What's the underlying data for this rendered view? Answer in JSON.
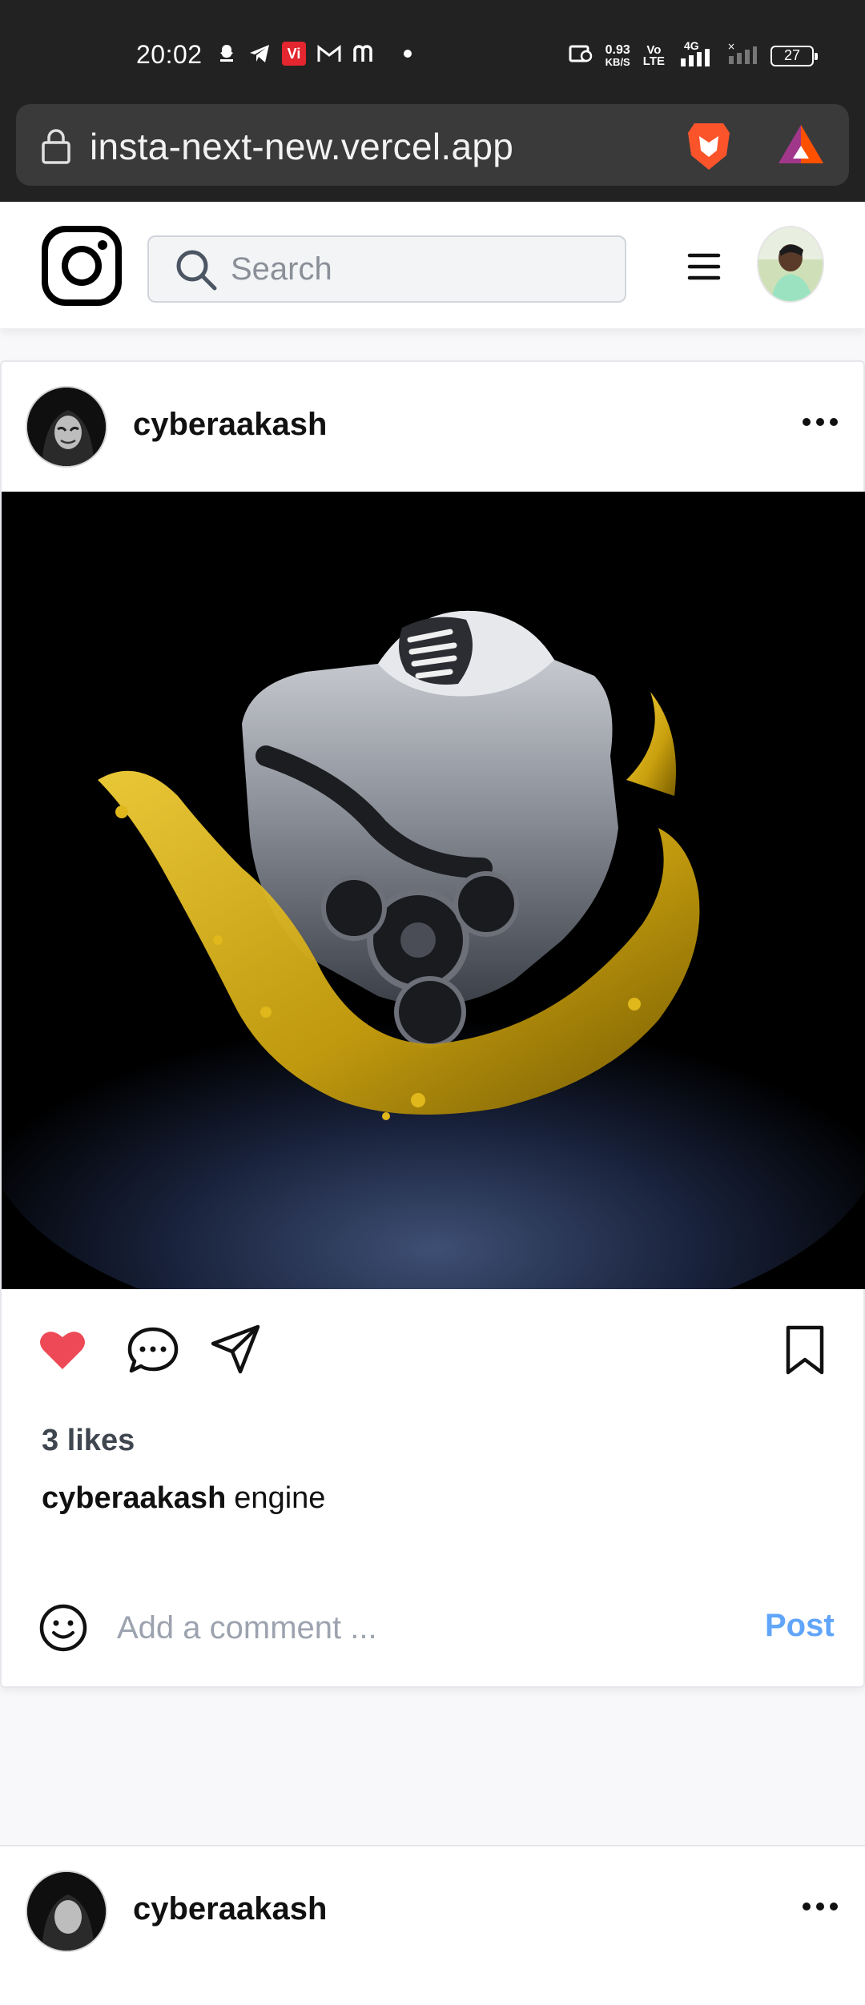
{
  "status_bar": {
    "time": "20:02",
    "net_speed_value": "0.93",
    "net_speed_unit": "KB/S",
    "volte_top": "Vo",
    "volte_bottom": "LTE",
    "network": "4G",
    "battery": "27",
    "left_icons": [
      "snapchat-icon",
      "telegram-icon",
      "vi-icon",
      "gmail-icon",
      "m-icon",
      "dot"
    ],
    "vi_label": "Vi"
  },
  "browser": {
    "url": "insta-next-new.vercel.app",
    "icons": [
      "lock-icon",
      "brave-lion-icon",
      "brave-rewards-icon"
    ]
  },
  "header": {
    "search_placeholder": "Search",
    "icons": [
      "instagram-logo",
      "search-icon",
      "menu-icon",
      "avatar"
    ]
  },
  "posts": [
    {
      "username": "cyberaakash",
      "likes_text": "3 likes",
      "caption_user": "cyberaakash",
      "caption_text": "engine",
      "comment_placeholder": "Add a comment ...",
      "post_button": "Post",
      "liked": true,
      "icons": [
        "more-icon",
        "heart-icon",
        "comment-icon",
        "share-icon",
        "bookmark-icon",
        "emoji-icon"
      ]
    },
    {
      "username": "cyberaakash"
    }
  ],
  "colors": {
    "status_bg": "#222222",
    "url_pill": "#3a3a3a",
    "heart": "#ed4956",
    "post_button": "#60a5fa",
    "likes_text": "#3f4650"
  }
}
